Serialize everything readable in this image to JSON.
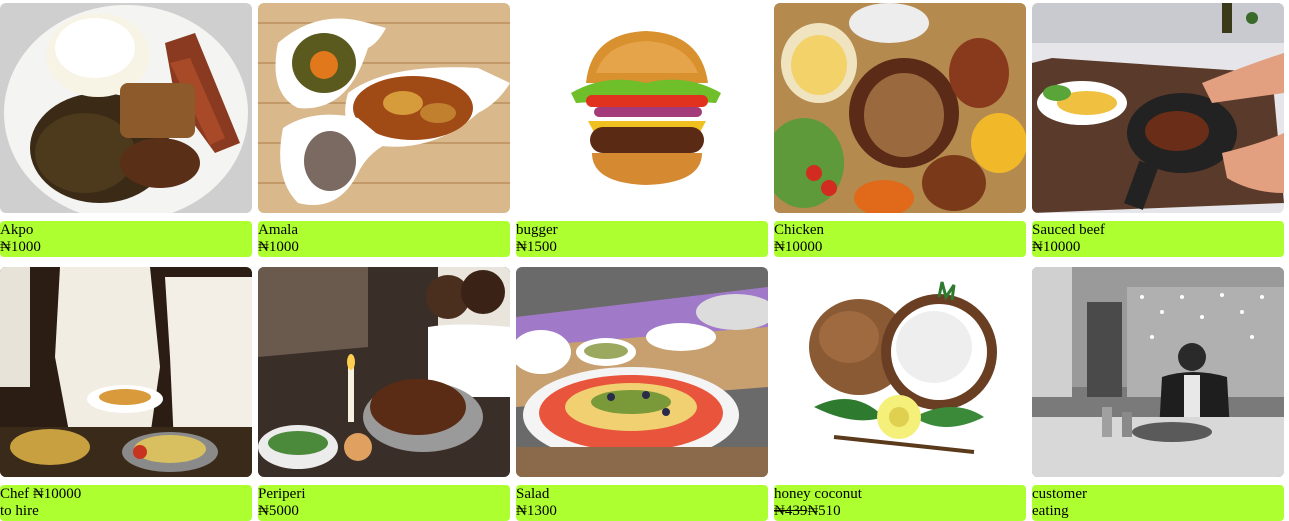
{
  "menu": {
    "items": [
      {
        "name": "Akpo",
        "price": "₦1000",
        "image": "fufu-with-egusi-and-meat"
      },
      {
        "name": "Amala",
        "price": "₦1000",
        "image": "amala-with-soups"
      },
      {
        "name": "bugger",
        "price": "₦1500",
        "image": "cheeseburger"
      },
      {
        "name": "Chicken",
        "price": "₦10000",
        "image": "chicken-platter"
      },
      {
        "name": "Sauced beef",
        "price": "₦10000",
        "image": "steak-in-skillet"
      },
      {
        "name": "Chef ₦10000",
        "price": "to hire",
        "image": "chefs-serving-food"
      },
      {
        "name": "Periperi",
        "price": "₦5000",
        "image": "family-roast-dinner"
      },
      {
        "name": "Salad",
        "price": "₦1300",
        "image": "fruit-salad-platter"
      },
      {
        "name": "honey coconut",
        "old_price": "₦439",
        "price": "₦510",
        "image": "coconut-with-flower"
      },
      {
        "name": "customer",
        "price": "eating",
        "image": "man-eating-in-restaurant"
      }
    ]
  },
  "colors": {
    "label_background": "#adff2f",
    "page_background": "#ffffff"
  }
}
